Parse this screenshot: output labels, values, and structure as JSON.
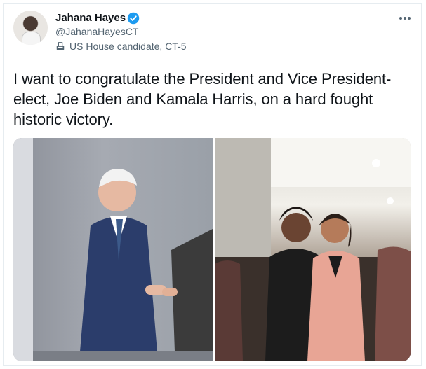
{
  "user": {
    "display_name": "Jahana Hayes",
    "handle": "@JahanaHayesCT",
    "label": "US House candidate, CT-5"
  },
  "tweet": {
    "text": "I want to congratulate the President and Vice President-elect, Joe Biden and Kamala Harris, on a hard fought historic victory."
  },
  "icons": {
    "verified": "verified-badge-icon",
    "ballot": "ballot-box-icon",
    "more": "more-options-icon"
  },
  "colors": {
    "verified": "#1d9bf0",
    "text": "#0f1419",
    "secondary": "#536471",
    "border": "#e6ecf0"
  }
}
